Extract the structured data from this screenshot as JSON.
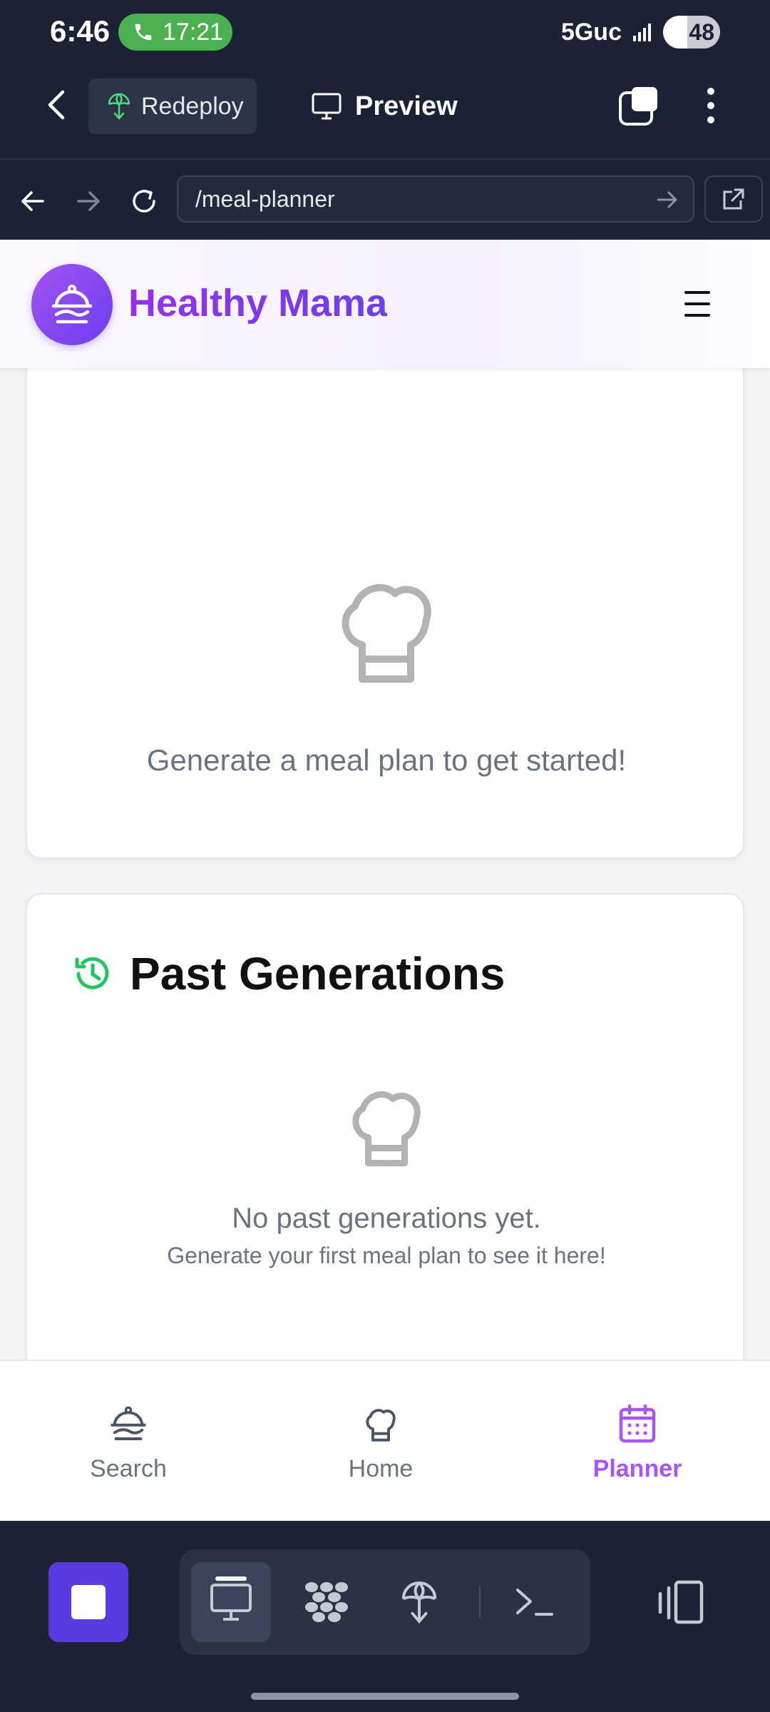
{
  "status_bar": {
    "time": "6:46",
    "call_duration": "17:21",
    "network": "5Guc",
    "battery": "48"
  },
  "app_toolbar": {
    "redeploy_label": "Redeploy",
    "preview_label": "Preview"
  },
  "url_bar": {
    "path": "/meal-planner"
  },
  "site": {
    "title": "Healthy Mama"
  },
  "meal_plan_card": {
    "empty_message": "Generate a meal plan to get started!"
  },
  "past_generations": {
    "title": "Past Generations",
    "empty_title": "No past generations yet.",
    "empty_subtitle": "Generate your first meal plan to see it here!"
  },
  "bottom_nav": {
    "items": [
      {
        "label": "Search",
        "icon": "serving-dish-icon",
        "active": false
      },
      {
        "label": "Home",
        "icon": "chef-hat-icon",
        "active": false
      },
      {
        "label": "Planner",
        "icon": "calendar-icon",
        "active": true
      }
    ]
  },
  "colors": {
    "brand_purple": "#9333ea",
    "accent_green": "#22c55e",
    "dark_chrome": "#1b2233"
  }
}
